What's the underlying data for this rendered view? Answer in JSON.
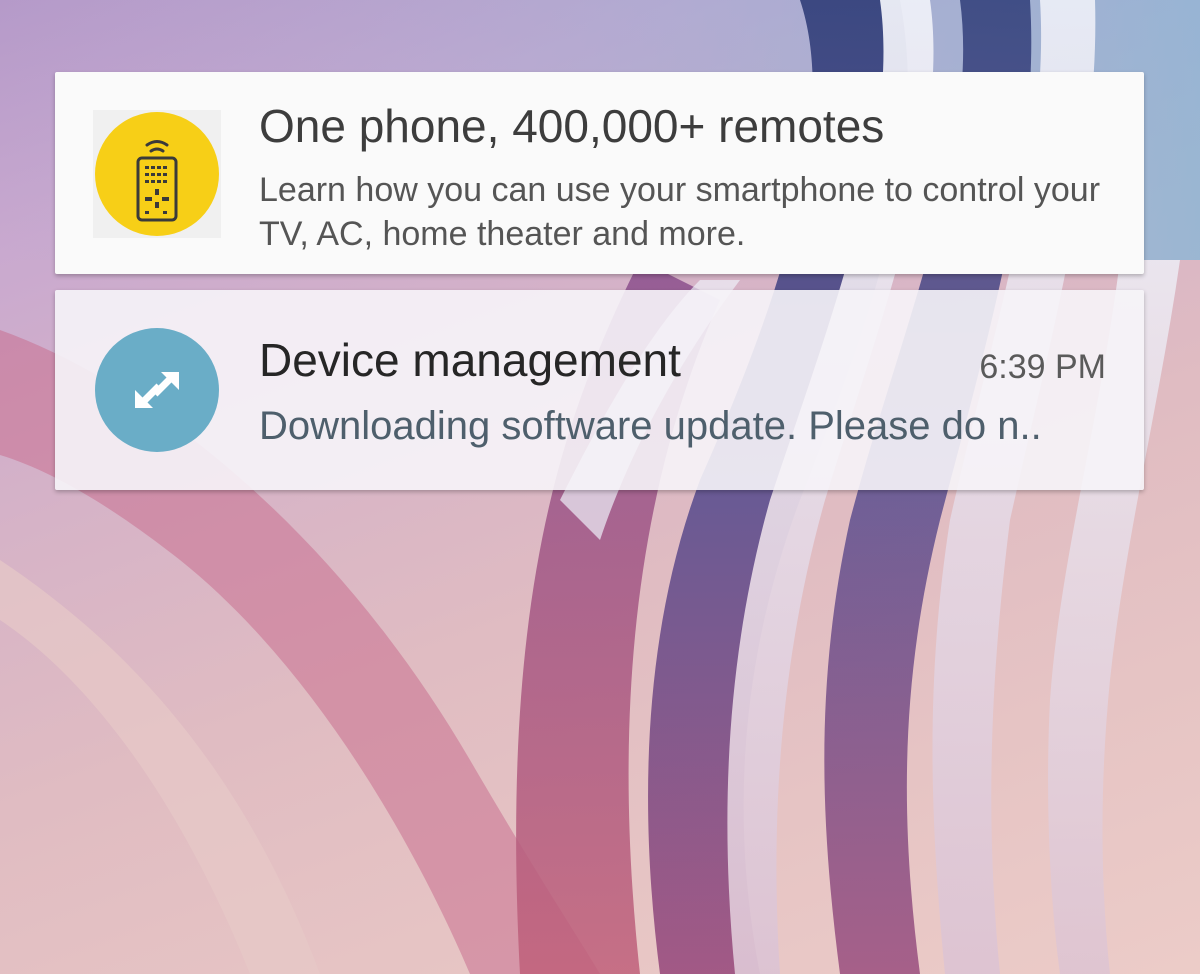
{
  "notifications": {
    "promo": {
      "icon": "remote-control-icon",
      "icon_color": "#f7cf17",
      "title": "One phone, 400,000+ remotes",
      "body": "Learn how you can use your smartphone to control your TV, AC, home theater and more."
    },
    "device": {
      "icon": "sync-arrows-icon",
      "icon_color": "#6aadc7",
      "title": "Device management",
      "time": "6:39 PM",
      "body": "Downloading software update. Please do n.."
    }
  }
}
